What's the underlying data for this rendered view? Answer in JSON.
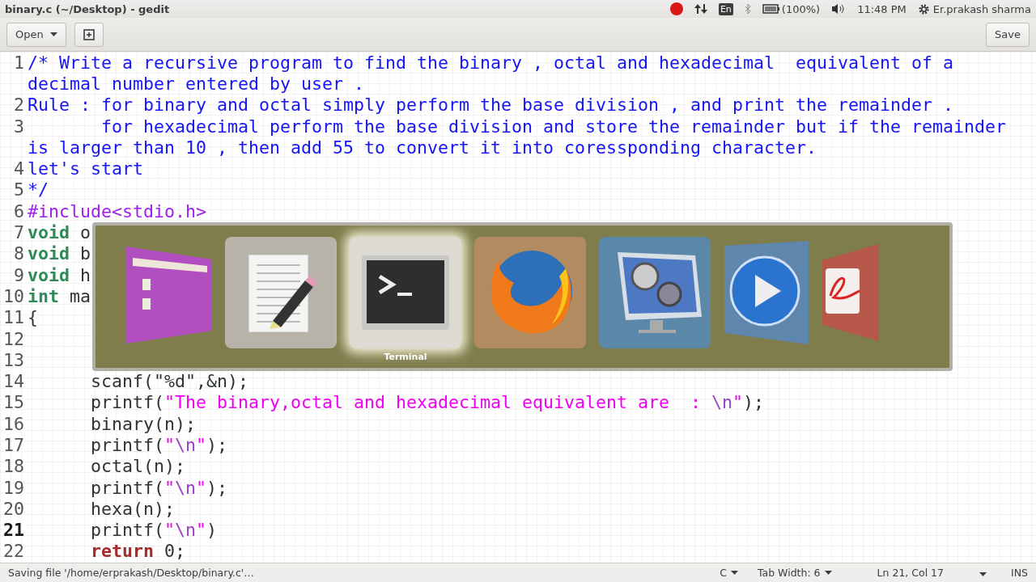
{
  "window": {
    "title": "binary.c (~/Desktop) - gedit"
  },
  "indicators": {
    "keyboard": "En",
    "battery": "(100%)",
    "clock": "11:48 PM",
    "user": "Er.prakash sharma"
  },
  "toolbar": {
    "open": "Open",
    "save": "Save"
  },
  "editor": {
    "lines": [
      {
        "number": "1",
        "current": false,
        "rows": [
          [
            {
              "kind": "comment",
              "text": "/* Write a recursive program to find the binary , octal and hexadecimal  equivalent of a"
            }
          ],
          [
            {
              "kind": "comment",
              "text": "decimal number entered by user ."
            }
          ]
        ]
      },
      {
        "number": "2",
        "current": false,
        "rows": [
          [
            {
              "kind": "comment",
              "text": "Rule : for binary and octal simply perform the base division , and print the remainder ."
            }
          ]
        ]
      },
      {
        "number": "3",
        "current": false,
        "rows": [
          [
            {
              "kind": "comment",
              "text": "\t for hexadecimal perform the base division and store the remainder but if the remainder"
            }
          ],
          [
            {
              "kind": "comment",
              "text": "is larger than 10 , then add 55 to convert it into coressponding character."
            }
          ]
        ]
      },
      {
        "number": "4",
        "current": false,
        "rows": [
          [
            {
              "kind": "comment",
              "text": "let's start"
            }
          ]
        ]
      },
      {
        "number": "5",
        "current": false,
        "rows": [
          [
            {
              "kind": "comment",
              "text": "*/"
            }
          ]
        ]
      },
      {
        "number": "6",
        "current": false,
        "rows": [
          [
            {
              "kind": "preproc",
              "text": "#include<stdio.h>"
            }
          ]
        ]
      },
      {
        "number": "7",
        "current": false,
        "rows": [
          [
            {
              "kind": "type",
              "text": "void"
            },
            {
              "kind": "plain",
              "text": " o"
            }
          ]
        ]
      },
      {
        "number": "8",
        "current": false,
        "rows": [
          [
            {
              "kind": "type",
              "text": "void"
            },
            {
              "kind": "plain",
              "text": " b"
            }
          ]
        ]
      },
      {
        "number": "9",
        "current": false,
        "rows": [
          [
            {
              "kind": "type",
              "text": "void"
            },
            {
              "kind": "plain",
              "text": " h"
            }
          ]
        ]
      },
      {
        "number": "10",
        "current": false,
        "rows": [
          [
            {
              "kind": "type",
              "text": "int"
            },
            {
              "kind": "plain",
              "text": " ma"
            }
          ]
        ]
      },
      {
        "number": "11",
        "current": false,
        "rows": [
          [
            {
              "kind": "plain",
              "text": "{"
            }
          ]
        ]
      },
      {
        "number": "12",
        "current": false,
        "rows": [
          []
        ]
      },
      {
        "number": "13",
        "current": false,
        "rows": [
          []
        ]
      },
      {
        "number": "14",
        "current": false,
        "rows": [
          [
            {
              "kind": "plain",
              "text": "\tscanf(\"%d\",&n);"
            }
          ]
        ]
      },
      {
        "number": "15",
        "current": false,
        "rows": [
          [
            {
              "kind": "plain",
              "text": "\tprintf("
            },
            {
              "kind": "string",
              "text": "\"The binary,octal and hexadecimal equivalent are  : "
            },
            {
              "kind": "escape",
              "text": "\\n"
            },
            {
              "kind": "string",
              "text": "\""
            },
            {
              "kind": "plain",
              "text": ");"
            }
          ]
        ]
      },
      {
        "number": "16",
        "current": false,
        "rows": [
          [
            {
              "kind": "plain",
              "text": "\tbinary(n);"
            }
          ]
        ]
      },
      {
        "number": "17",
        "current": false,
        "rows": [
          [
            {
              "kind": "plain",
              "text": "\tprintf("
            },
            {
              "kind": "string",
              "text": "\""
            },
            {
              "kind": "escape",
              "text": "\\n"
            },
            {
              "kind": "string",
              "text": "\""
            },
            {
              "kind": "plain",
              "text": ");"
            }
          ]
        ]
      },
      {
        "number": "18",
        "current": false,
        "rows": [
          [
            {
              "kind": "plain",
              "text": "\toctal(n);"
            }
          ]
        ]
      },
      {
        "number": "19",
        "current": false,
        "rows": [
          [
            {
              "kind": "plain",
              "text": "\tprintf("
            },
            {
              "kind": "string",
              "text": "\""
            },
            {
              "kind": "escape",
              "text": "\\n"
            },
            {
              "kind": "string",
              "text": "\""
            },
            {
              "kind": "plain",
              "text": ");"
            }
          ]
        ]
      },
      {
        "number": "20",
        "current": false,
        "rows": [
          [
            {
              "kind": "plain",
              "text": "\thexa(n);"
            }
          ]
        ]
      },
      {
        "number": "21",
        "current": true,
        "rows": [
          [
            {
              "kind": "plain",
              "text": "\tprintf("
            },
            {
              "kind": "string",
              "text": "\""
            },
            {
              "kind": "escape",
              "text": "\\n"
            },
            {
              "kind": "string",
              "text": "\""
            },
            {
              "kind": "plain",
              "text": ")"
            }
          ]
        ]
      },
      {
        "number": "22",
        "current": false,
        "rows": [
          [
            {
              "kind": "plain",
              "text": "\t"
            },
            {
              "kind": "keyword",
              "text": "return"
            },
            {
              "kind": "plain",
              "text": " 0;"
            }
          ]
        ]
      }
    ]
  },
  "switcher": {
    "apps": [
      {
        "kind": "files",
        "selected": false
      },
      {
        "kind": "editor",
        "selected": false
      },
      {
        "kind": "terminal",
        "selected": true,
        "label": "Terminal"
      },
      {
        "kind": "browser",
        "selected": false
      },
      {
        "kind": "media",
        "selected": false
      },
      {
        "kind": "player",
        "selected": false
      },
      {
        "kind": "document",
        "selected": false
      }
    ]
  },
  "status_bar": {
    "message": "Saving file '/home/erprakash/Desktop/binary.c'…",
    "language": "C",
    "tab_width": "Tab Width: 6",
    "position": "Ln 21, Col 17",
    "mode": "INS"
  }
}
